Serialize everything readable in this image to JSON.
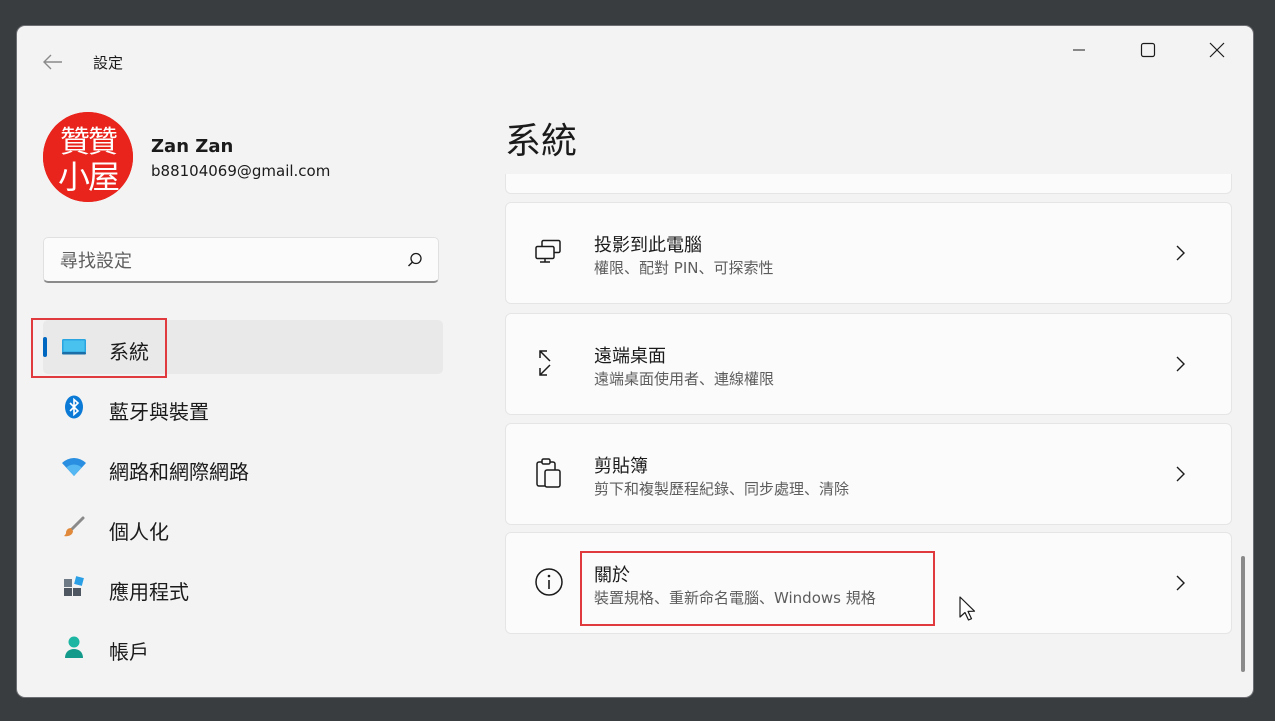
{
  "window": {
    "title": "設定"
  },
  "user": {
    "name": "Zan Zan",
    "email": "b88104069@gmail.com",
    "avatar_text": "贊贊小屋"
  },
  "search": {
    "placeholder": "尋找設定"
  },
  "sidebar": {
    "items": [
      {
        "label": "系統",
        "icon": "monitor-icon",
        "selected": true
      },
      {
        "label": "藍牙與裝置",
        "icon": "bluetooth-icon"
      },
      {
        "label": "網路和網際網路",
        "icon": "wifi-icon"
      },
      {
        "label": "個人化",
        "icon": "paintbrush-icon"
      },
      {
        "label": "應用程式",
        "icon": "apps-icon"
      },
      {
        "label": "帳戶",
        "icon": "person-icon"
      }
    ]
  },
  "main": {
    "title": "系統",
    "cards": [
      {
        "title": "投影到此電腦",
        "subtitle": "權限、配對 PIN、可探索性",
        "icon": "projection-icon"
      },
      {
        "title": "遠端桌面",
        "subtitle": "遠端桌面使用者、連線權限",
        "icon": "remote-desktop-icon"
      },
      {
        "title": "剪貼簿",
        "subtitle": "剪下和複製歷程紀錄、同步處理、清除",
        "icon": "clipboard-icon"
      },
      {
        "title": "關於",
        "subtitle": "裝置規格、重新命名電腦、Windows 規格",
        "icon": "info-icon"
      }
    ]
  },
  "colors": {
    "accent": "#0067c0",
    "highlight": "#e0393e",
    "background": "#f3f3f3",
    "avatar": "#e8241c"
  }
}
